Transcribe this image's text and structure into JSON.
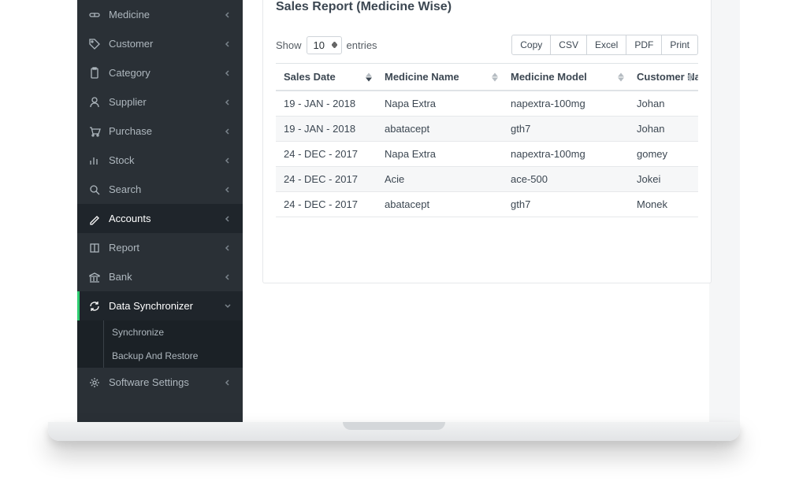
{
  "sidebar": {
    "items": [
      {
        "label": "Medicine",
        "icon": "pill",
        "state": "normal"
      },
      {
        "label": "Customer",
        "icon": "tag",
        "state": "normal"
      },
      {
        "label": "Category",
        "icon": "clipboard",
        "state": "normal"
      },
      {
        "label": "Supplier",
        "icon": "user",
        "state": "normal"
      },
      {
        "label": "Purchase",
        "icon": "cart",
        "state": "normal"
      },
      {
        "label": "Stock",
        "icon": "bars",
        "state": "normal"
      },
      {
        "label": "Search",
        "icon": "search",
        "state": "normal"
      },
      {
        "label": "Accounts",
        "icon": "pencil",
        "state": "active"
      },
      {
        "label": "Report",
        "icon": "book",
        "state": "normal"
      },
      {
        "label": "Bank",
        "icon": "bank",
        "state": "normal"
      },
      {
        "label": "Data Synchronizer",
        "icon": "sync",
        "state": "expanded",
        "children": [
          {
            "label": "Synchronize"
          },
          {
            "label": "Backup And Restore"
          }
        ]
      },
      {
        "label": "Software Settings",
        "icon": "gear",
        "state": "normal"
      }
    ]
  },
  "panel": {
    "title": "Sales Report (Medicine Wise)",
    "show_label": "Show",
    "entries_label": "entries",
    "page_length": "10",
    "buttons": [
      "Copy",
      "CSV",
      "Excel",
      "PDF",
      "Print"
    ],
    "columns": [
      "Sales Date",
      "Medicine Name",
      "Medicine Model",
      "Customer Name"
    ],
    "sorted_desc_index": 0,
    "rows": [
      [
        "19 - JAN - 2018",
        "Napa Extra",
        "napextra-100mg",
        "Johan"
      ],
      [
        "19 - JAN - 2018",
        "abatacept",
        "gth7",
        "Johan"
      ],
      [
        "24 - DEC - 2017",
        "Napa Extra",
        "napextra-100mg",
        "gomey"
      ],
      [
        "24 - DEC - 2017",
        "Acie",
        "ace-500",
        "Jokei"
      ],
      [
        "24 - DEC - 2017",
        "abatacept",
        "gth7",
        "Monek"
      ]
    ]
  }
}
